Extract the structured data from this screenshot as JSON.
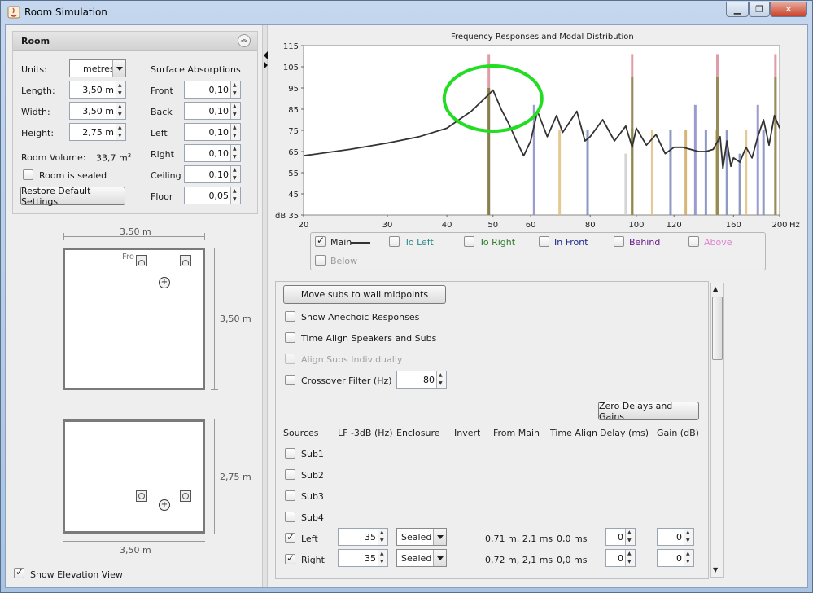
{
  "window": {
    "title": "Room Simulation",
    "controls": [
      "minimize",
      "maximize",
      "close"
    ]
  },
  "room": {
    "header": "Room",
    "units_label": "Units:",
    "units_value": "metres",
    "length_label": "Length:",
    "length_value": "3,50 m",
    "width_label": "Width:",
    "width_value": "3,50 m",
    "height_label": "Height:",
    "height_value": "2,75 m",
    "volume_label": "Room Volume:",
    "volume_value": "33,7 m",
    "volume_unit_sup": "3",
    "sealed_label": "Room is sealed",
    "sealed_checked": false,
    "restore_button": "Restore Default Settings",
    "absorptions_header": "Surface Absorptions",
    "absorptions": [
      {
        "label": "Front",
        "value": "0,10"
      },
      {
        "label": "Back",
        "value": "0,10"
      },
      {
        "label": "Left",
        "value": "0,10"
      },
      {
        "label": "Right",
        "value": "0,10"
      },
      {
        "label": "Ceiling",
        "value": "0,10"
      },
      {
        "label": "Floor",
        "value": "0,05"
      }
    ]
  },
  "plan_view": {
    "top_dim": "3,50 m",
    "side_dim": "3,50 m",
    "front_label": "Fro"
  },
  "elevation_view": {
    "side_dim": "2,75 m",
    "bottom_dim": "3,50 m"
  },
  "show_elevation": {
    "label": "Show Elevation View",
    "checked": true
  },
  "chart": {
    "title": "Frequency Responses and Modal Distribution",
    "y_unit": "dB",
    "x_unit": "Hz",
    "y_ticks": [
      "35",
      "45",
      "55",
      "65",
      "75",
      "85",
      "95",
      "105",
      "115"
    ],
    "x_ticks": [
      "20",
      "30",
      "40",
      "50",
      "60",
      "80",
      "100",
      "120",
      "160",
      "200"
    ]
  },
  "chart_data": {
    "type": "line",
    "title": "Frequency Responses and Modal Distribution",
    "xlabel": "Hz",
    "ylabel": "dB",
    "x_scale": "log",
    "xlim": [
      20,
      200
    ],
    "ylim": [
      35,
      115
    ],
    "series": [
      {
        "name": "Main",
        "x": [
          20,
          25,
          30,
          35,
          40,
          45,
          48,
          50,
          52,
          54,
          56,
          58,
          60,
          62,
          65,
          68,
          70,
          72,
          75,
          78,
          80,
          85,
          90,
          95,
          98,
          100,
          105,
          110,
          115,
          120,
          125,
          130,
          135,
          140,
          145,
          150,
          152,
          155,
          158,
          160,
          165,
          170,
          175,
          180,
          185,
          190,
          195,
          200
        ],
        "y": [
          63,
          66,
          69,
          72,
          76,
          84,
          90,
          94,
          85,
          78,
          70,
          63,
          70,
          84,
          72,
          82,
          74,
          78,
          84,
          70,
          72,
          80,
          70,
          77,
          67,
          76,
          68,
          73,
          64,
          67,
          67,
          66,
          65,
          65,
          66,
          72,
          57,
          70,
          58,
          62,
          60,
          67,
          62,
          72,
          80,
          68,
          82,
          76
        ]
      }
    ],
    "modes": [
      {
        "x": 49,
        "top": 111,
        "color": "#d98c9a"
      },
      {
        "x": 49,
        "top": 95,
        "color": "#7a7a3c"
      },
      {
        "x": 61,
        "top": 87,
        "color": "#8a8ac8"
      },
      {
        "x": 69,
        "top": 75,
        "color": "#e0c080"
      },
      {
        "x": 79,
        "top": 75,
        "color": "#7a88b8"
      },
      {
        "x": 95,
        "top": 64,
        "color": "#cccccc"
      },
      {
        "x": 98,
        "top": 111,
        "color": "#d98c9a"
      },
      {
        "x": 98,
        "top": 100,
        "color": "#8a8a4a"
      },
      {
        "x": 98,
        "top": 76,
        "color": "#8a8a4a"
      },
      {
        "x": 108,
        "top": 75,
        "color": "#e0c080"
      },
      {
        "x": 118,
        "top": 75,
        "color": "#7a88b8"
      },
      {
        "x": 127,
        "top": 75,
        "color": "#cfa860"
      },
      {
        "x": 133,
        "top": 87,
        "color": "#8a8ac8"
      },
      {
        "x": 140,
        "top": 75,
        "color": "#7a88b8"
      },
      {
        "x": 147,
        "top": 75,
        "color": "#e0c080"
      },
      {
        "x": 148,
        "top": 111,
        "color": "#d98c9a"
      },
      {
        "x": 148,
        "top": 100,
        "color": "#8a8a4a"
      },
      {
        "x": 155,
        "top": 75,
        "color": "#7a88b8"
      },
      {
        "x": 165,
        "top": 64,
        "color": "#7a88b8"
      },
      {
        "x": 170,
        "top": 75,
        "color": "#e0c080"
      },
      {
        "x": 180,
        "top": 87,
        "color": "#8a8ac8"
      },
      {
        "x": 185,
        "top": 75,
        "color": "#7a88b8"
      },
      {
        "x": 196,
        "top": 111,
        "color": "#d98c9a"
      },
      {
        "x": 196,
        "top": 100,
        "color": "#8a8a4a"
      }
    ],
    "annotation": {
      "shape": "ellipse",
      "color": "#22dd22",
      "center_x": 50,
      "center_y": 90
    }
  },
  "legend": [
    {
      "label": "Main",
      "checked": true,
      "color": "#222222"
    },
    {
      "label": "To Left",
      "checked": false,
      "color": "#2a8a8a"
    },
    {
      "label": "To Right",
      "checked": false,
      "color": "#2a7a2a"
    },
    {
      "label": "In Front",
      "checked": false,
      "color": "#1a2a8a"
    },
    {
      "label": "Behind",
      "checked": false,
      "color": "#6a1a8a"
    },
    {
      "label": "Above",
      "checked": false,
      "color": "#e080d0"
    },
    {
      "label": "Below",
      "checked": false,
      "color": "#999999"
    }
  ],
  "options": {
    "move_subs_button": "Move subs to wall midpoints",
    "show_anechoic": "Show Anechoic Responses",
    "time_align": "Time Align Speakers and Subs",
    "align_subs": "Align Subs Individually",
    "crossover_label": "Crossover Filter (Hz)",
    "crossover_value": "80",
    "zero_button": "Zero Delays and Gains"
  },
  "sources_table": {
    "headers": [
      "Sources",
      "LF -3dB (Hz)",
      "Enclosure",
      "Invert",
      "From Main",
      "Time Align",
      "Delay (ms)",
      "Gain (dB)"
    ],
    "rows": [
      {
        "name": "Sub1",
        "checked": false
      },
      {
        "name": "Sub2",
        "checked": false
      },
      {
        "name": "Sub3",
        "checked": false
      },
      {
        "name": "Sub4",
        "checked": false
      },
      {
        "name": "Left",
        "checked": true,
        "lf": "35",
        "enclosure": "Sealed",
        "from_main": "0,71 m, 2,1 ms",
        "time_align": "0,0 ms",
        "delay": "0",
        "gain": "0"
      },
      {
        "name": "Right",
        "checked": true,
        "lf": "35",
        "enclosure": "Sealed",
        "from_main": "0,72 m, 2,1 ms",
        "time_align": "0,0 ms",
        "delay": "0",
        "gain": "0"
      }
    ]
  }
}
